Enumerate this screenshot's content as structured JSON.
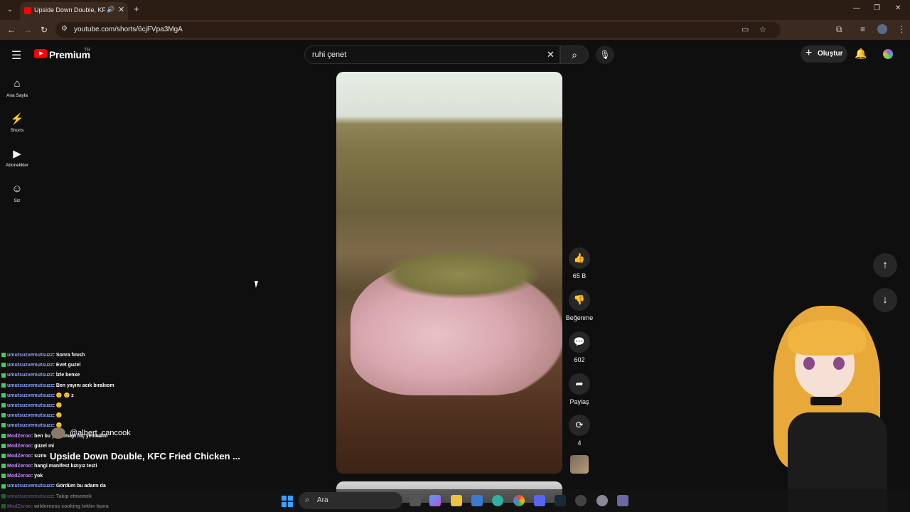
{
  "browser": {
    "tab_title": "Upside Down Double, KFC Fried Chicken ...",
    "url": "youtube.com/shorts/6cjFVpa3MgA",
    "new_tab": "+",
    "minimize": "—",
    "restore": "❐",
    "close": "✕"
  },
  "youtube": {
    "brand": "Premium",
    "country": "TR",
    "search_value": "ruhi çenet",
    "create_label": "Oluştur"
  },
  "sidebar": {
    "items": [
      {
        "label": "Ana Sayfa",
        "icon": "⌂"
      },
      {
        "label": "Shorts",
        "icon": "⚡"
      },
      {
        "label": "Abonelikler",
        "icon": "▶"
      },
      {
        "label": "Siz",
        "icon": "☺"
      }
    ]
  },
  "actions": {
    "like_count": "65 B",
    "dislike_label": "Beğenme",
    "comment_count": "602",
    "share_label": "Paylaş",
    "remix_count": "4"
  },
  "video": {
    "channel": "@albert_cancook",
    "title": "Upside Down Double, KFC Fried Chicken ..."
  },
  "chat": [
    {
      "user": "umutsuzvemutsuzz",
      "text": ": Sonra fınısh",
      "kind": "a"
    },
    {
      "user": "umutsuzvemutsuzz",
      "text": ": Evet guzel",
      "kind": "a"
    },
    {
      "user": "umutsuzvemutsuzz",
      "text": ": İzle benxe",
      "kind": "a"
    },
    {
      "user": "umutsuzvemutsuzz",
      "text": ": Ben yayını acık bırakıom",
      "kind": "a"
    },
    {
      "user": "umutsuzvemutsuzz",
      "text": ": 🙂 🙂 z",
      "kind": "a"
    },
    {
      "user": "umutsuzvemutsuzz",
      "text": ": 🙂",
      "kind": "a"
    },
    {
      "user": "umutsuzvemutsuzz",
      "text": ": 🙂",
      "kind": "a"
    },
    {
      "user": "umutsuzvemutsuzz",
      "text": ": 🙂",
      "kind": "a"
    },
    {
      "user": "ModZeroo",
      "text": ": ben bu yağlamayı hiç yemedim",
      "kind": "b"
    },
    {
      "user": "ModZeroo",
      "text": ": güzel mi",
      "kind": "b"
    },
    {
      "user": "ModZeroo",
      "text": ": sızmı",
      "kind": "b"
    },
    {
      "user": "ModZeroo",
      "text": ": hangi manifest kızıyız testi",
      "kind": "b"
    },
    {
      "user": "ModZeroo",
      "text": ": yok",
      "kind": "b"
    },
    {
      "user": "umutsuzvemutsuzz",
      "text": ": Gördüm bu adamı da",
      "kind": "a"
    },
    {
      "user": "umutsuzvemutsuzz",
      "text": ": Takip etmemek",
      "kind": "a"
    },
    {
      "user": "ModZeroo",
      "text": ": wilderness cooking tekler bunu",
      "kind": "b"
    }
  ],
  "taskbar": {
    "search_placeholder": "Ara"
  },
  "colors": {
    "youtube_red": "#ff0000",
    "accent_blue": "#3aa0ff",
    "chat_badge": "#3ad060"
  }
}
